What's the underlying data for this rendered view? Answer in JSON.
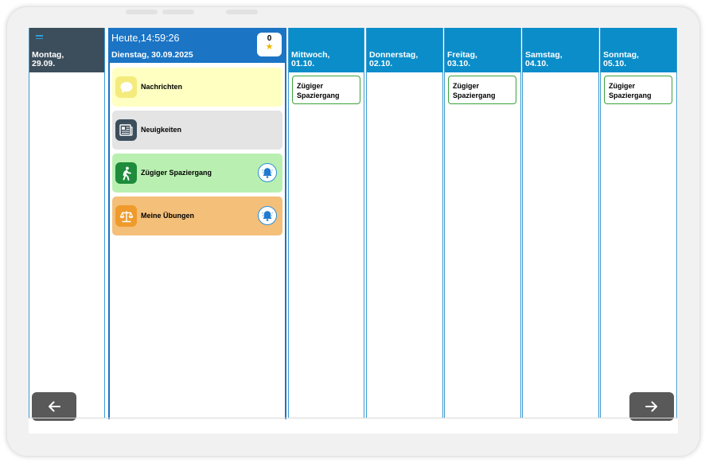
{
  "today": {
    "time_label": "Heute,14:59:26",
    "date_label": "Dienstag, 30.09.2025",
    "score": "0",
    "score_icon": "star-icon"
  },
  "past_day": {
    "weekday": "Montag,",
    "date": "29.09."
  },
  "today_items": [
    {
      "label": "Nachrichten",
      "icon": "chat-bubble-icon",
      "bg": "#ffffc2",
      "icon_bg": "#f4eb7c",
      "has_bell": false
    },
    {
      "label": "Neuigkeiten",
      "icon": "newspaper-icon",
      "bg": "#e4e4e4",
      "icon_bg": "#3c4e5c",
      "has_bell": false
    },
    {
      "label": "Zügiger Spaziergang",
      "icon": "walking-person-icon",
      "bg": "#b9f0b1",
      "icon_bg": "#1e8c3b",
      "has_bell": true
    },
    {
      "label": "Meine Übungen",
      "icon": "scales-icon",
      "bg": "#f4bf79",
      "icon_bg": "#ee9a2c",
      "has_bell": true
    }
  ],
  "days": [
    {
      "weekday": "Mittwoch,",
      "date": "01.10.",
      "task_line1": "Zügiger",
      "task_line2": "Spaziergang"
    },
    {
      "weekday": "Donnerstag,",
      "date": "02.10."
    },
    {
      "weekday": "Freitag,",
      "date": "03.10.",
      "task_line1": "Zügiger",
      "task_line2": "Spaziergang"
    },
    {
      "weekday": "Samstag,",
      "date": "04.10."
    },
    {
      "weekday": "Sonntag,",
      "date": "05.10.",
      "task_line1": "Zügiger",
      "task_line2": "Spaziergang"
    }
  ],
  "colors": {
    "header_blue": "#0a8dc9",
    "today_blue": "#1b74c4",
    "past_header": "#3c4e5c",
    "task_border": "#3aa33a",
    "nav_button": "#595959"
  },
  "nav": {
    "prev_icon": "arrow-left-icon",
    "next_icon": "arrow-right-icon"
  }
}
